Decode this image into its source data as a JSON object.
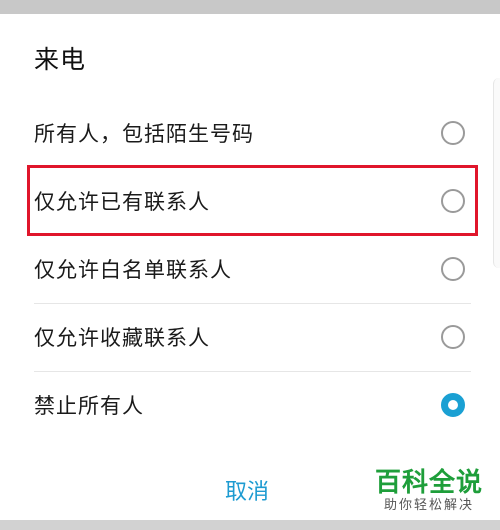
{
  "dialog": {
    "title": "来电",
    "options": [
      {
        "label": "所有人，包括陌生号码",
        "selected": false
      },
      {
        "label": "仅允许已有联系人",
        "selected": false
      },
      {
        "label": "仅允许白名单联系人",
        "selected": false
      },
      {
        "label": "仅允许收藏联系人",
        "selected": false
      },
      {
        "label": "禁止所有人",
        "selected": true
      }
    ],
    "cancel_label": "取消"
  },
  "colors": {
    "accent": "#1aa0d3",
    "highlight": "#e0162b",
    "watermark": "#1e9e3a"
  },
  "watermark": {
    "main": "百科全说",
    "sub": "助你轻松解决"
  }
}
